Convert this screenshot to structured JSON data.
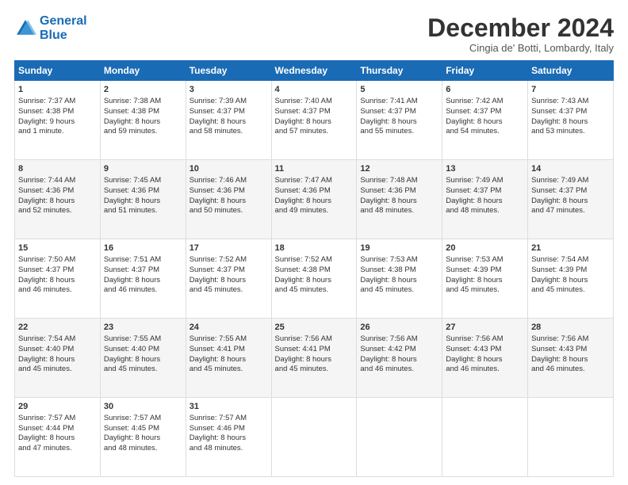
{
  "logo": {
    "line1": "General",
    "line2": "Blue"
  },
  "title": "December 2024",
  "subtitle": "Cingia de' Botti, Lombardy, Italy",
  "days_of_week": [
    "Sunday",
    "Monday",
    "Tuesday",
    "Wednesday",
    "Thursday",
    "Friday",
    "Saturday"
  ],
  "weeks": [
    [
      {
        "day": 1,
        "lines": [
          "Sunrise: 7:37 AM",
          "Sunset: 4:38 PM",
          "Daylight: 9 hours",
          "and 1 minute."
        ]
      },
      {
        "day": 2,
        "lines": [
          "Sunrise: 7:38 AM",
          "Sunset: 4:38 PM",
          "Daylight: 8 hours",
          "and 59 minutes."
        ]
      },
      {
        "day": 3,
        "lines": [
          "Sunrise: 7:39 AM",
          "Sunset: 4:37 PM",
          "Daylight: 8 hours",
          "and 58 minutes."
        ]
      },
      {
        "day": 4,
        "lines": [
          "Sunrise: 7:40 AM",
          "Sunset: 4:37 PM",
          "Daylight: 8 hours",
          "and 57 minutes."
        ]
      },
      {
        "day": 5,
        "lines": [
          "Sunrise: 7:41 AM",
          "Sunset: 4:37 PM",
          "Daylight: 8 hours",
          "and 55 minutes."
        ]
      },
      {
        "day": 6,
        "lines": [
          "Sunrise: 7:42 AM",
          "Sunset: 4:37 PM",
          "Daylight: 8 hours",
          "and 54 minutes."
        ]
      },
      {
        "day": 7,
        "lines": [
          "Sunrise: 7:43 AM",
          "Sunset: 4:37 PM",
          "Daylight: 8 hours",
          "and 53 minutes."
        ]
      }
    ],
    [
      {
        "day": 8,
        "lines": [
          "Sunrise: 7:44 AM",
          "Sunset: 4:36 PM",
          "Daylight: 8 hours",
          "and 52 minutes."
        ]
      },
      {
        "day": 9,
        "lines": [
          "Sunrise: 7:45 AM",
          "Sunset: 4:36 PM",
          "Daylight: 8 hours",
          "and 51 minutes."
        ]
      },
      {
        "day": 10,
        "lines": [
          "Sunrise: 7:46 AM",
          "Sunset: 4:36 PM",
          "Daylight: 8 hours",
          "and 50 minutes."
        ]
      },
      {
        "day": 11,
        "lines": [
          "Sunrise: 7:47 AM",
          "Sunset: 4:36 PM",
          "Daylight: 8 hours",
          "and 49 minutes."
        ]
      },
      {
        "day": 12,
        "lines": [
          "Sunrise: 7:48 AM",
          "Sunset: 4:36 PM",
          "Daylight: 8 hours",
          "and 48 minutes."
        ]
      },
      {
        "day": 13,
        "lines": [
          "Sunrise: 7:49 AM",
          "Sunset: 4:37 PM",
          "Daylight: 8 hours",
          "and 48 minutes."
        ]
      },
      {
        "day": 14,
        "lines": [
          "Sunrise: 7:49 AM",
          "Sunset: 4:37 PM",
          "Daylight: 8 hours",
          "and 47 minutes."
        ]
      }
    ],
    [
      {
        "day": 15,
        "lines": [
          "Sunrise: 7:50 AM",
          "Sunset: 4:37 PM",
          "Daylight: 8 hours",
          "and 46 minutes."
        ]
      },
      {
        "day": 16,
        "lines": [
          "Sunrise: 7:51 AM",
          "Sunset: 4:37 PM",
          "Daylight: 8 hours",
          "and 46 minutes."
        ]
      },
      {
        "day": 17,
        "lines": [
          "Sunrise: 7:52 AM",
          "Sunset: 4:37 PM",
          "Daylight: 8 hours",
          "and 45 minutes."
        ]
      },
      {
        "day": 18,
        "lines": [
          "Sunrise: 7:52 AM",
          "Sunset: 4:38 PM",
          "Daylight: 8 hours",
          "and 45 minutes."
        ]
      },
      {
        "day": 19,
        "lines": [
          "Sunrise: 7:53 AM",
          "Sunset: 4:38 PM",
          "Daylight: 8 hours",
          "and 45 minutes."
        ]
      },
      {
        "day": 20,
        "lines": [
          "Sunrise: 7:53 AM",
          "Sunset: 4:39 PM",
          "Daylight: 8 hours",
          "and 45 minutes."
        ]
      },
      {
        "day": 21,
        "lines": [
          "Sunrise: 7:54 AM",
          "Sunset: 4:39 PM",
          "Daylight: 8 hours",
          "and 45 minutes."
        ]
      }
    ],
    [
      {
        "day": 22,
        "lines": [
          "Sunrise: 7:54 AM",
          "Sunset: 4:40 PM",
          "Daylight: 8 hours",
          "and 45 minutes."
        ]
      },
      {
        "day": 23,
        "lines": [
          "Sunrise: 7:55 AM",
          "Sunset: 4:40 PM",
          "Daylight: 8 hours",
          "and 45 minutes."
        ]
      },
      {
        "day": 24,
        "lines": [
          "Sunrise: 7:55 AM",
          "Sunset: 4:41 PM",
          "Daylight: 8 hours",
          "and 45 minutes."
        ]
      },
      {
        "day": 25,
        "lines": [
          "Sunrise: 7:56 AM",
          "Sunset: 4:41 PM",
          "Daylight: 8 hours",
          "and 45 minutes."
        ]
      },
      {
        "day": 26,
        "lines": [
          "Sunrise: 7:56 AM",
          "Sunset: 4:42 PM",
          "Daylight: 8 hours",
          "and 46 minutes."
        ]
      },
      {
        "day": 27,
        "lines": [
          "Sunrise: 7:56 AM",
          "Sunset: 4:43 PM",
          "Daylight: 8 hours",
          "and 46 minutes."
        ]
      },
      {
        "day": 28,
        "lines": [
          "Sunrise: 7:56 AM",
          "Sunset: 4:43 PM",
          "Daylight: 8 hours",
          "and 46 minutes."
        ]
      }
    ],
    [
      {
        "day": 29,
        "lines": [
          "Sunrise: 7:57 AM",
          "Sunset: 4:44 PM",
          "Daylight: 8 hours",
          "and 47 minutes."
        ]
      },
      {
        "day": 30,
        "lines": [
          "Sunrise: 7:57 AM",
          "Sunset: 4:45 PM",
          "Daylight: 8 hours",
          "and 48 minutes."
        ]
      },
      {
        "day": 31,
        "lines": [
          "Sunrise: 7:57 AM",
          "Sunset: 4:46 PM",
          "Daylight: 8 hours",
          "and 48 minutes."
        ]
      },
      null,
      null,
      null,
      null
    ]
  ]
}
